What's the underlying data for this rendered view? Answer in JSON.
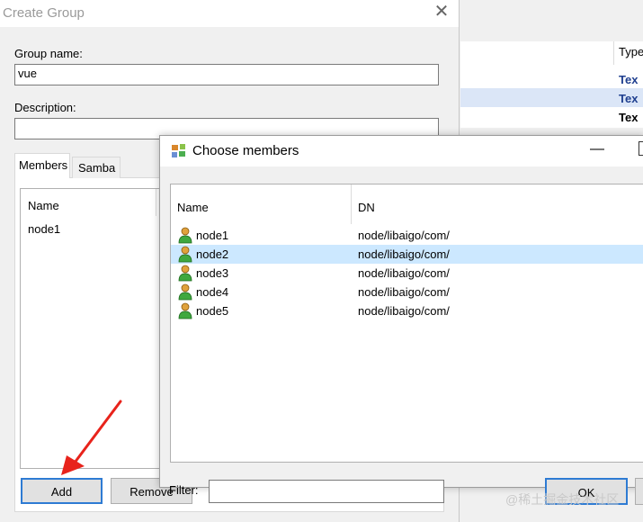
{
  "background": {
    "column_header": "Type",
    "rows": [
      "Tex",
      "Tex",
      "Tex"
    ]
  },
  "create_group": {
    "title": "Create Group",
    "group_name_label": "Group name:",
    "group_name_value": "vue",
    "description_label": "Description:",
    "description_value": "",
    "tabs": [
      "Members",
      "Samba"
    ],
    "members_list": {
      "column_header": "Name",
      "rows": [
        "node1"
      ]
    },
    "add_label": "Add",
    "remove_label": "Remove"
  },
  "choose_members": {
    "title": "Choose members",
    "columns": [
      "Name",
      "DN"
    ],
    "rows": [
      {
        "name": "node1",
        "dn": "node/libaigo/com/"
      },
      {
        "name": "node2",
        "dn": "node/libaigo/com/",
        "selected": true
      },
      {
        "name": "node3",
        "dn": "node/libaigo/com/"
      },
      {
        "name": "node4",
        "dn": "node/libaigo/com/"
      },
      {
        "name": "node5",
        "dn": "node/libaigo/com/"
      }
    ],
    "filter_label": "Filter:",
    "filter_value": "",
    "ok_label": "OK"
  },
  "watermark": "@稀土掘金技术社区",
  "colors": {
    "selection": "#cce8ff",
    "focus_border": "#2e7bd3",
    "arrow": "#e8231b"
  }
}
